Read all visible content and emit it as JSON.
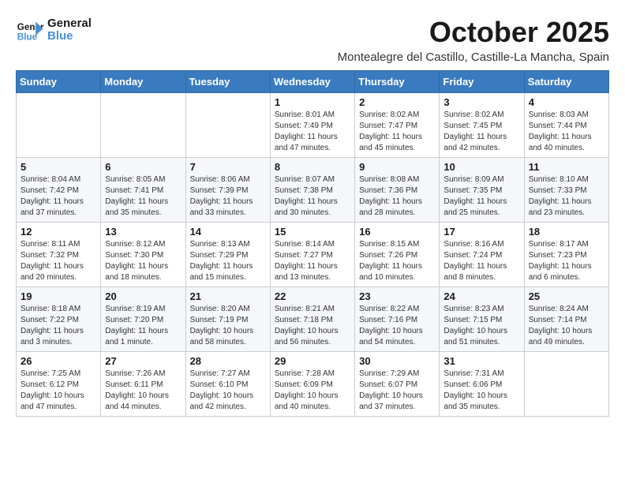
{
  "logo": {
    "line1": "General",
    "line2": "Blue"
  },
  "title": "October 2025",
  "subtitle": "Montealegre del Castillo, Castille-La Mancha, Spain",
  "weekdays": [
    "Sunday",
    "Monday",
    "Tuesday",
    "Wednesday",
    "Thursday",
    "Friday",
    "Saturday"
  ],
  "weeks": [
    [
      {
        "day": "",
        "text": ""
      },
      {
        "day": "",
        "text": ""
      },
      {
        "day": "",
        "text": ""
      },
      {
        "day": "1",
        "text": "Sunrise: 8:01 AM\nSunset: 7:49 PM\nDaylight: 11 hours\nand 47 minutes."
      },
      {
        "day": "2",
        "text": "Sunrise: 8:02 AM\nSunset: 7:47 PM\nDaylight: 11 hours\nand 45 minutes."
      },
      {
        "day": "3",
        "text": "Sunrise: 8:02 AM\nSunset: 7:45 PM\nDaylight: 11 hours\nand 42 minutes."
      },
      {
        "day": "4",
        "text": "Sunrise: 8:03 AM\nSunset: 7:44 PM\nDaylight: 11 hours\nand 40 minutes."
      }
    ],
    [
      {
        "day": "5",
        "text": "Sunrise: 8:04 AM\nSunset: 7:42 PM\nDaylight: 11 hours\nand 37 minutes."
      },
      {
        "day": "6",
        "text": "Sunrise: 8:05 AM\nSunset: 7:41 PM\nDaylight: 11 hours\nand 35 minutes."
      },
      {
        "day": "7",
        "text": "Sunrise: 8:06 AM\nSunset: 7:39 PM\nDaylight: 11 hours\nand 33 minutes."
      },
      {
        "day": "8",
        "text": "Sunrise: 8:07 AM\nSunset: 7:38 PM\nDaylight: 11 hours\nand 30 minutes."
      },
      {
        "day": "9",
        "text": "Sunrise: 8:08 AM\nSunset: 7:36 PM\nDaylight: 11 hours\nand 28 minutes."
      },
      {
        "day": "10",
        "text": "Sunrise: 8:09 AM\nSunset: 7:35 PM\nDaylight: 11 hours\nand 25 minutes."
      },
      {
        "day": "11",
        "text": "Sunrise: 8:10 AM\nSunset: 7:33 PM\nDaylight: 11 hours\nand 23 minutes."
      }
    ],
    [
      {
        "day": "12",
        "text": "Sunrise: 8:11 AM\nSunset: 7:32 PM\nDaylight: 11 hours\nand 20 minutes."
      },
      {
        "day": "13",
        "text": "Sunrise: 8:12 AM\nSunset: 7:30 PM\nDaylight: 11 hours\nand 18 minutes."
      },
      {
        "day": "14",
        "text": "Sunrise: 8:13 AM\nSunset: 7:29 PM\nDaylight: 11 hours\nand 15 minutes."
      },
      {
        "day": "15",
        "text": "Sunrise: 8:14 AM\nSunset: 7:27 PM\nDaylight: 11 hours\nand 13 minutes."
      },
      {
        "day": "16",
        "text": "Sunrise: 8:15 AM\nSunset: 7:26 PM\nDaylight: 11 hours\nand 10 minutes."
      },
      {
        "day": "17",
        "text": "Sunrise: 8:16 AM\nSunset: 7:24 PM\nDaylight: 11 hours\nand 8 minutes."
      },
      {
        "day": "18",
        "text": "Sunrise: 8:17 AM\nSunset: 7:23 PM\nDaylight: 11 hours\nand 6 minutes."
      }
    ],
    [
      {
        "day": "19",
        "text": "Sunrise: 8:18 AM\nSunset: 7:22 PM\nDaylight: 11 hours\nand 3 minutes."
      },
      {
        "day": "20",
        "text": "Sunrise: 8:19 AM\nSunset: 7:20 PM\nDaylight: 11 hours\nand 1 minute."
      },
      {
        "day": "21",
        "text": "Sunrise: 8:20 AM\nSunset: 7:19 PM\nDaylight: 10 hours\nand 58 minutes."
      },
      {
        "day": "22",
        "text": "Sunrise: 8:21 AM\nSunset: 7:18 PM\nDaylight: 10 hours\nand 56 minutes."
      },
      {
        "day": "23",
        "text": "Sunrise: 8:22 AM\nSunset: 7:16 PM\nDaylight: 10 hours\nand 54 minutes."
      },
      {
        "day": "24",
        "text": "Sunrise: 8:23 AM\nSunset: 7:15 PM\nDaylight: 10 hours\nand 51 minutes."
      },
      {
        "day": "25",
        "text": "Sunrise: 8:24 AM\nSunset: 7:14 PM\nDaylight: 10 hours\nand 49 minutes."
      }
    ],
    [
      {
        "day": "26",
        "text": "Sunrise: 7:25 AM\nSunset: 6:12 PM\nDaylight: 10 hours\nand 47 minutes."
      },
      {
        "day": "27",
        "text": "Sunrise: 7:26 AM\nSunset: 6:11 PM\nDaylight: 10 hours\nand 44 minutes."
      },
      {
        "day": "28",
        "text": "Sunrise: 7:27 AM\nSunset: 6:10 PM\nDaylight: 10 hours\nand 42 minutes."
      },
      {
        "day": "29",
        "text": "Sunrise: 7:28 AM\nSunset: 6:09 PM\nDaylight: 10 hours\nand 40 minutes."
      },
      {
        "day": "30",
        "text": "Sunrise: 7:29 AM\nSunset: 6:07 PM\nDaylight: 10 hours\nand 37 minutes."
      },
      {
        "day": "31",
        "text": "Sunrise: 7:31 AM\nSunset: 6:06 PM\nDaylight: 10 hours\nand 35 minutes."
      },
      {
        "day": "",
        "text": ""
      }
    ]
  ]
}
